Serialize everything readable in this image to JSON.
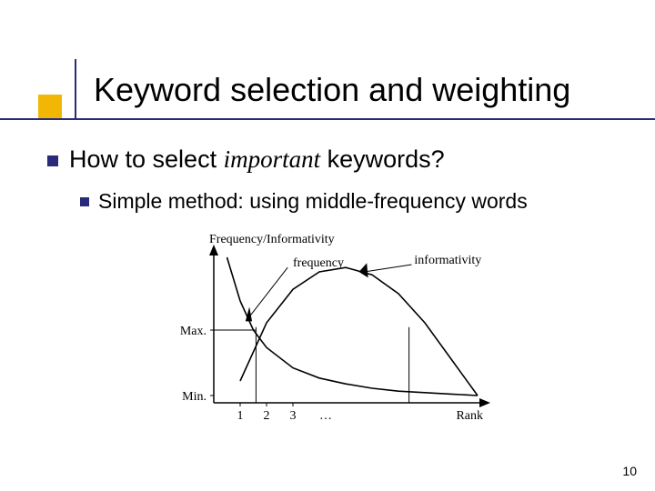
{
  "slide": {
    "title": "Keyword selection and weighting",
    "bullet1_prefix": "How to select ",
    "bullet1_italic": "important",
    "bullet1_suffix": " keywords?",
    "bullet2": "Simple method: using middle-frequency words",
    "page_number": "10"
  },
  "chart_data": {
    "type": "line",
    "title": "Frequency/Informativity",
    "xlabel": "Rank",
    "ylabel": "",
    "x_ticks": [
      "1",
      "2",
      "3",
      "…"
    ],
    "y_ticks": [
      "Min.",
      "Max."
    ],
    "xlim": [
      0,
      10
    ],
    "ylim": [
      0,
      1
    ],
    "series": [
      {
        "name": "frequency",
        "x": [
          0.5,
          1,
          1.5,
          2,
          3,
          4,
          5,
          6,
          7,
          8,
          9,
          10
        ],
        "values": [
          1.0,
          0.7,
          0.5,
          0.38,
          0.24,
          0.17,
          0.13,
          0.1,
          0.08,
          0.07,
          0.06,
          0.05
        ]
      },
      {
        "name": "informativity",
        "x": [
          1,
          2,
          3,
          4,
          5,
          6,
          7,
          8,
          9,
          10
        ],
        "values": [
          0.15,
          0.55,
          0.78,
          0.9,
          0.93,
          0.88,
          0.75,
          0.55,
          0.3,
          0.05
        ]
      }
    ],
    "annotations": [
      {
        "text": "frequency",
        "target_series": "frequency",
        "arrow": true
      },
      {
        "text": "informativity",
        "target_series": "informativity",
        "arrow": true
      }
    ],
    "guides": {
      "vertical_at_x": [
        1.6,
        7.4
      ],
      "horizontal_at_y": [
        0.5
      ]
    }
  }
}
